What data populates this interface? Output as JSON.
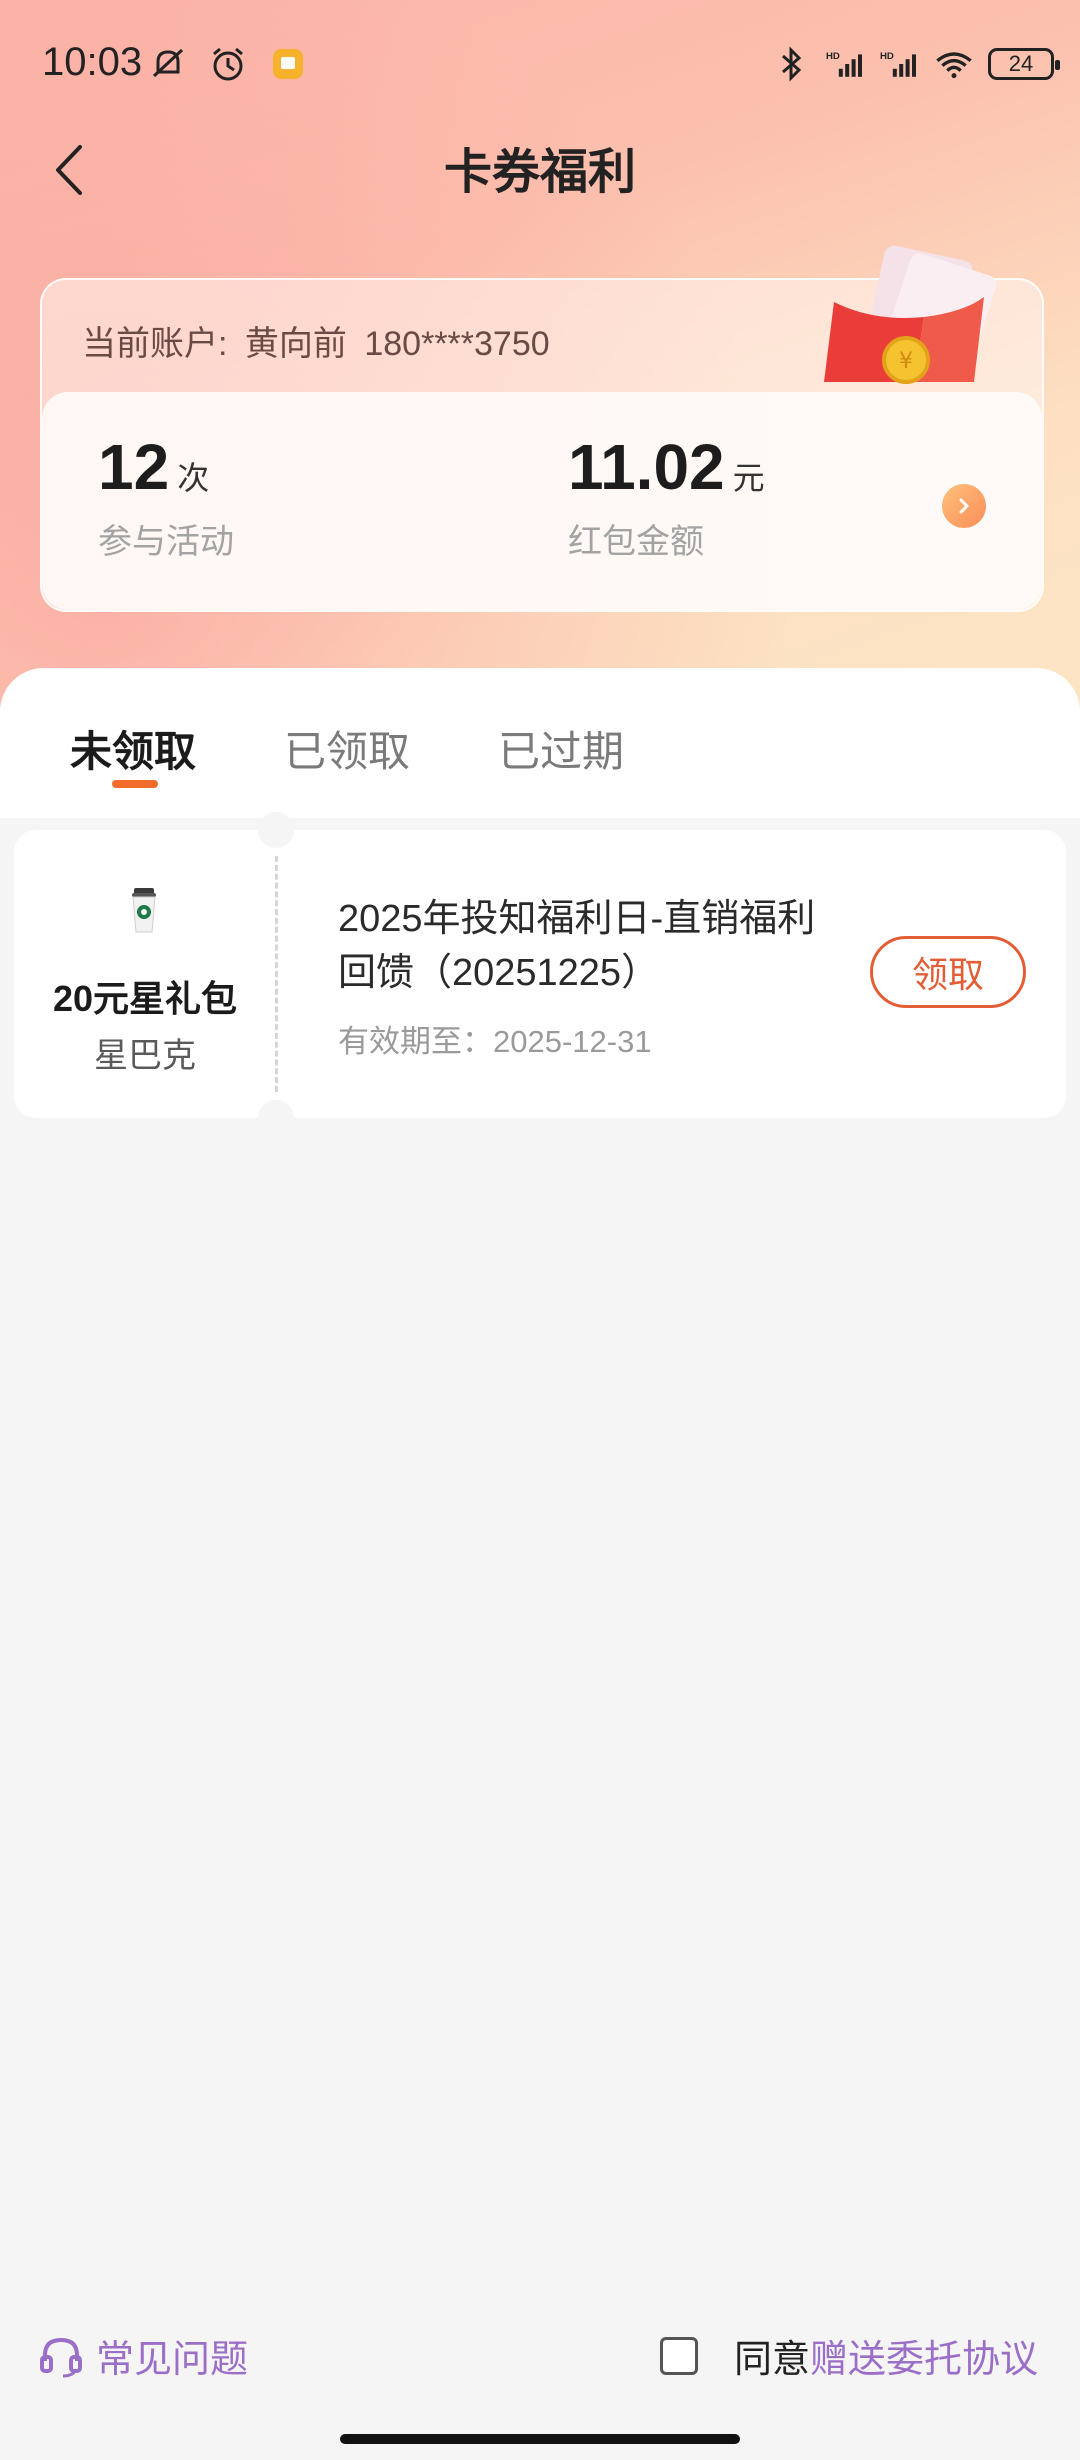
{
  "status_bar": {
    "time": "10:03",
    "battery": "24",
    "icons": [
      "mute-icon",
      "alarm-icon",
      "notification-app-icon",
      "bluetooth-icon",
      "signal-hd-icon",
      "signal-hd-icon",
      "wifi-icon"
    ]
  },
  "header": {
    "title": "卡券福利",
    "back_icon": "chevron-left-icon"
  },
  "account": {
    "label": "当前账户:",
    "name": "黄向前",
    "phone": "180****3750"
  },
  "stats": {
    "activities": {
      "value": "12",
      "unit": "次",
      "label": "参与活动"
    },
    "redpacket": {
      "value": "11.02",
      "unit": "元",
      "label": "红包金额"
    }
  },
  "tabs": [
    {
      "label": "未领取",
      "active": true
    },
    {
      "label": "已领取",
      "active": false
    },
    {
      "label": "已过期",
      "active": false
    }
  ],
  "coupons": [
    {
      "gift_name": "20元星礼包",
      "brand": "星巴克",
      "title_line1": "2025年投知福利日-直销福利",
      "title_line2": "回馈（20251225）",
      "expiry": "有效期至：2025-12-31",
      "button": "领取"
    }
  ],
  "footer": {
    "faq": "常见问题",
    "agree_prefix": "同意",
    "agree_link": "赠送委托协议"
  },
  "colors": {
    "accent": "#e35d36",
    "tab_indicator": "#f26b2a",
    "link": "#9b6ec8"
  }
}
